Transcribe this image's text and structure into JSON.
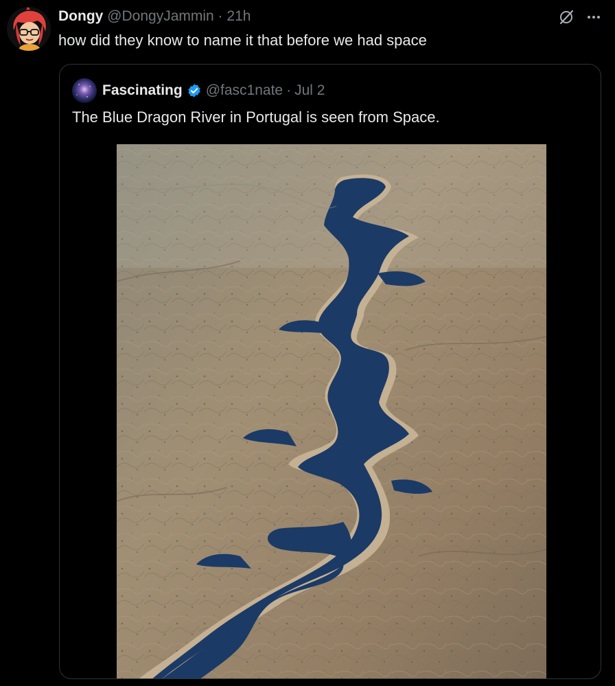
{
  "tweet": {
    "author_name": "Dongy",
    "author_handle": "@DongyJammin",
    "separator": "·",
    "time": "21h",
    "text": "how did they know to name it that before we had space",
    "avatar_icon": "cartoon-avatar-icon"
  },
  "quoted": {
    "author_name": "Fascinating",
    "author_handle": "@fasc1nate",
    "separator": "·",
    "date": "Jul 2",
    "verified": true,
    "text": "The Blue Dragon River in Portugal is seen from Space.",
    "avatar_icon": "galaxy-avatar-icon",
    "media_description_icon": "aerial-river-photo"
  },
  "actions": {
    "grok_icon": "grok-icon",
    "more_icon": "more-horizontal-icon",
    "more_label": "···"
  },
  "colors": {
    "background": "#000000",
    "text": "#e7e9ea",
    "muted": "#71767b",
    "border": "#2f3336",
    "verified": "#1d9bf0",
    "river": "#1b3a66",
    "land": "#9a8a72"
  }
}
